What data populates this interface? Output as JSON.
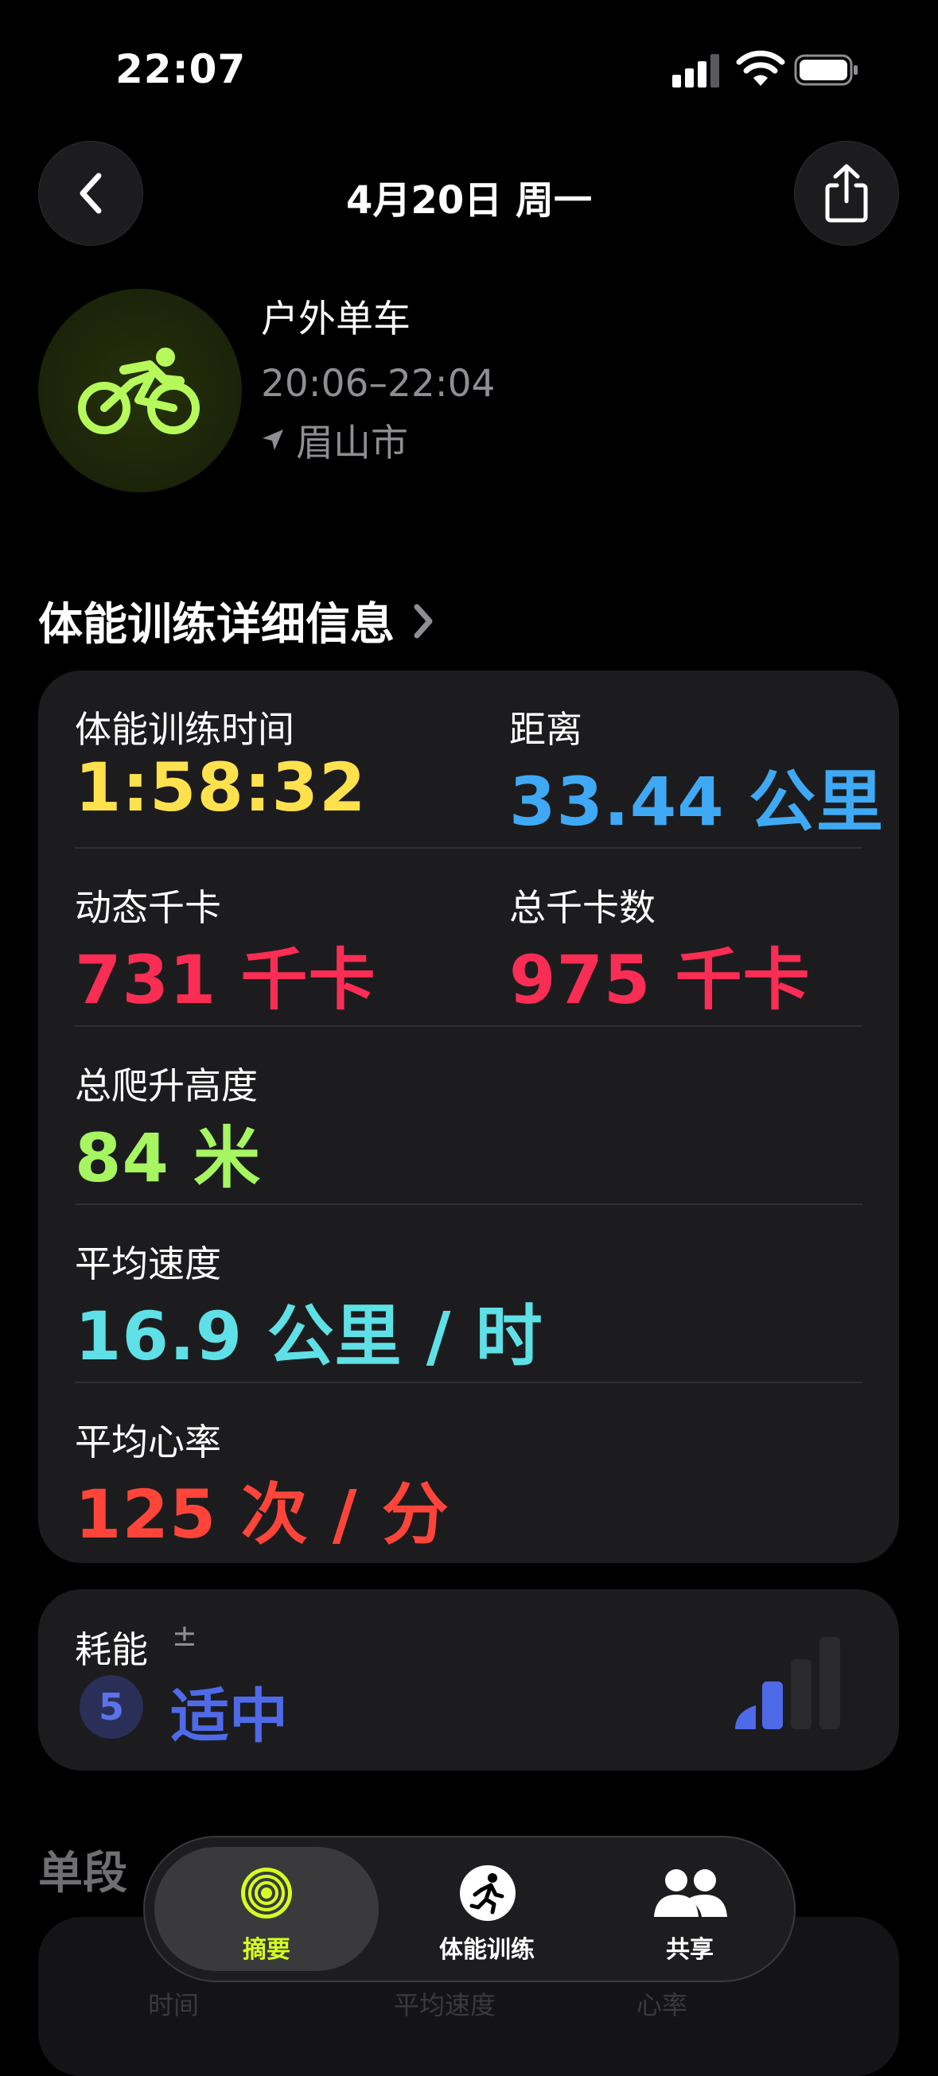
{
  "status_bar": {
    "time": "22:07"
  },
  "nav": {
    "title": "4月20日 周一"
  },
  "workout": {
    "type": "户外单车",
    "time_range": "20:06–22:04",
    "location": "眉山市"
  },
  "details": {
    "section_title": "体能训练详细信息",
    "metrics": {
      "workout_time": {
        "label": "体能训练时间",
        "value": "1:58:32",
        "color": "#ffe14d"
      },
      "distance": {
        "label": "距离",
        "value": "33.44 公里",
        "color": "#3fa9f5"
      },
      "active_kcal": {
        "label": "动态千卡",
        "value": "731 千卡",
        "color": "#fa2d55"
      },
      "total_kcal": {
        "label": "总千卡数",
        "value": "975 千卡",
        "color": "#fa2d55"
      },
      "elevation": {
        "label": "总爬升高度",
        "value": "84 米",
        "color": "#a6f561"
      },
      "avg_speed": {
        "label": "平均速度",
        "value": "16.9 公里 / 时",
        "color": "#5ee0e6"
      },
      "avg_hr": {
        "label": "平均心率",
        "value": "125 次 / 分",
        "color": "#ff453a"
      }
    }
  },
  "effort": {
    "label": "耗能",
    "modifier": "±",
    "level": "5",
    "rating": "适中",
    "color": "#4f6ae8",
    "bars_filled": 2,
    "bars_total": 4
  },
  "segments": {
    "title": "单段",
    "columns": [
      "时间",
      "平均速度",
      "心率"
    ]
  },
  "tabbar": {
    "tabs": [
      {
        "label": "摘要",
        "icon": "activity-rings-icon",
        "active": true
      },
      {
        "label": "体能训练",
        "icon": "running-figure-icon",
        "active": false
      },
      {
        "label": "共享",
        "icon": "sharing-people-icon",
        "active": false
      }
    ]
  }
}
